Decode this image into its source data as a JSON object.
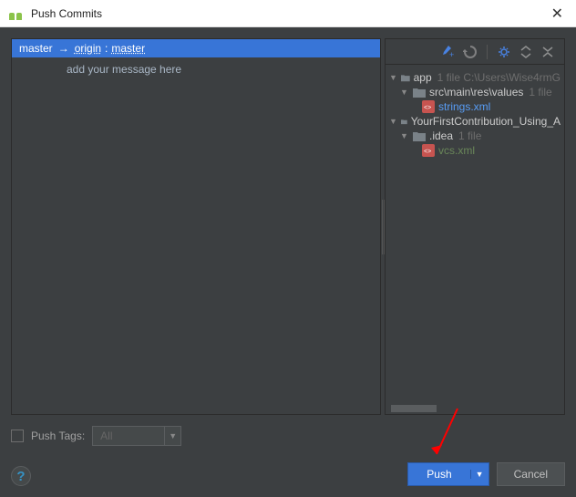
{
  "window": {
    "title": "Push Commits"
  },
  "commit": {
    "local_branch": "master",
    "arrow": "→",
    "remote": "origin",
    "sep": ":",
    "remote_branch": "master",
    "message": "add your message here"
  },
  "tree": {
    "app": {
      "name": "app",
      "meta": "1 file  C:\\Users\\Wise4rmG"
    },
    "src_path": {
      "name": "src\\main\\res\\values",
      "meta": "1 file"
    },
    "strings_file": "strings.xml",
    "project": {
      "name": "YourFirstContribution_Using_A"
    },
    "idea": {
      "name": ".idea",
      "meta": "1 file"
    },
    "vcs_file": "vcs.xml"
  },
  "tags": {
    "checkbox_label": "Push Tags:",
    "value": "All"
  },
  "buttons": {
    "push": "Push",
    "cancel": "Cancel"
  }
}
